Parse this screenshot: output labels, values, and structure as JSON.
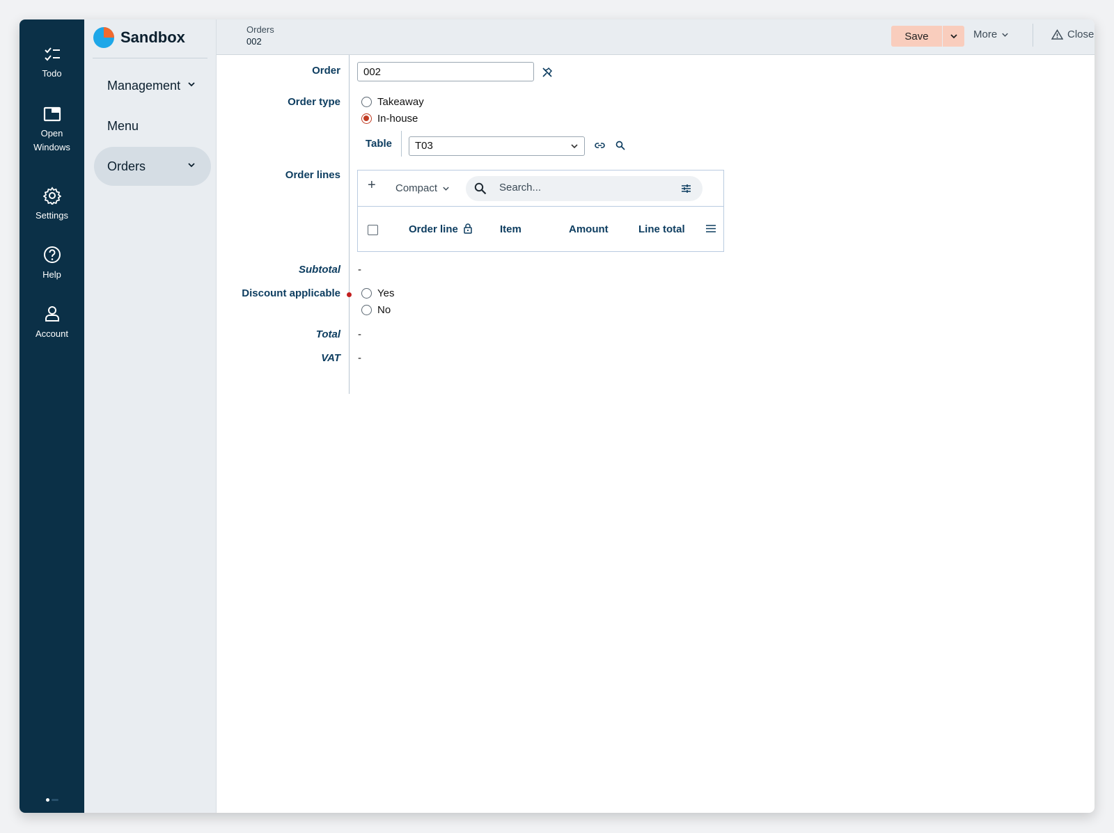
{
  "rail": {
    "items": [
      {
        "label": "Todo",
        "icon": "todo-list-icon"
      },
      {
        "label": "Open\nWindows",
        "icon": "window-icon"
      },
      {
        "label": "Settings",
        "icon": "gear-icon"
      },
      {
        "label": "Help",
        "icon": "help-circle-icon"
      },
      {
        "label": "Account",
        "icon": "user-icon"
      }
    ]
  },
  "nav": {
    "brand": "Sandbox",
    "items": [
      {
        "label": "Management",
        "has_chevron": true
      },
      {
        "label": "Menu",
        "has_chevron": false
      },
      {
        "label": "Orders",
        "has_chevron": true,
        "active": true
      }
    ]
  },
  "topbar": {
    "breadcrumb_parent": "Orders",
    "breadcrumb_current": "002",
    "save_label": "Save",
    "more_label": "More",
    "close_label": "Close"
  },
  "form": {
    "order_label": "Order",
    "order_value": "002",
    "order_type_label": "Order type",
    "order_type_options": [
      "Takeaway",
      "In-house"
    ],
    "order_type_selected": "In-house",
    "table_label": "Table",
    "table_value": "T03",
    "order_lines_label": "Order lines",
    "grid": {
      "view_mode": "Compact",
      "search_placeholder": "Search...",
      "columns": [
        "Order line",
        "Item",
        "Amount",
        "Line total"
      ]
    },
    "subtotal_label": "Subtotal",
    "subtotal_value": "-",
    "discount_label": "Discount applicable",
    "discount_options": [
      "Yes",
      "No"
    ],
    "total_label": "Total",
    "total_value": "-",
    "vat_label": "VAT",
    "vat_value": "-"
  },
  "colors": {
    "rail_bg": "#0b3047",
    "nav_bg": "#e9edf1",
    "save_bg": "#f9cdbd",
    "label_color": "#0c3c5f",
    "radio_selected": "#c03b22",
    "brand_logo": "#1ea7e8"
  }
}
